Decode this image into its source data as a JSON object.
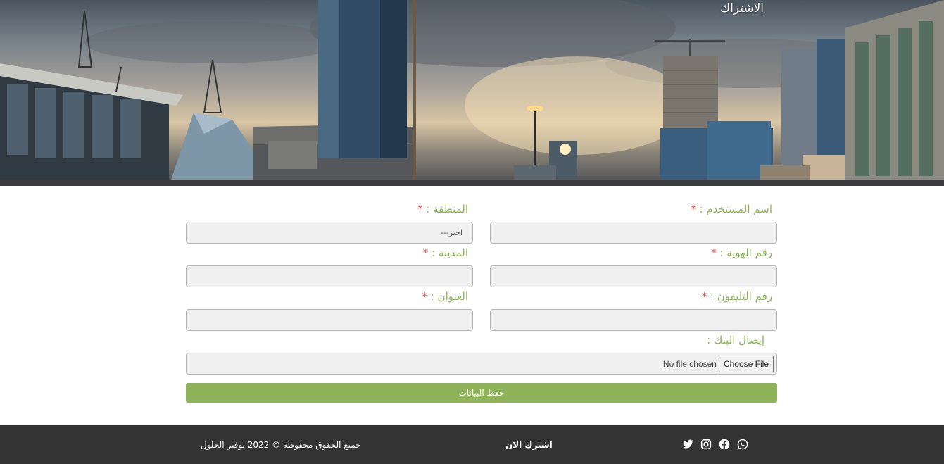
{
  "hero": {
    "title": "الاشتراك"
  },
  "form": {
    "username_label": "اسم المستخدم :",
    "region_label": "المنطقة :",
    "region_placeholder": "اختر---",
    "id_label": "رقم الهوية :",
    "city_label": "المدينة :",
    "phone_label": "رقم التليفون :",
    "address_label": "العنوان :",
    "receipt_label": "إيصال البنك :",
    "required_mark": "*",
    "choose_file_label": "Choose File",
    "no_file_text": "No file chosen",
    "submit_label": "حفظ البيانات"
  },
  "footer": {
    "copyright": "جميع الحقوق محفوظة © 2022 توفير الحلول",
    "subscribe": "اشترك الان",
    "social_icons": [
      "twitter-icon",
      "instagram-icon",
      "facebook-icon",
      "whatsapp-icon"
    ]
  },
  "colors": {
    "accent": "#8fb35a",
    "required": "#e53935",
    "footer_bg": "#333333"
  }
}
